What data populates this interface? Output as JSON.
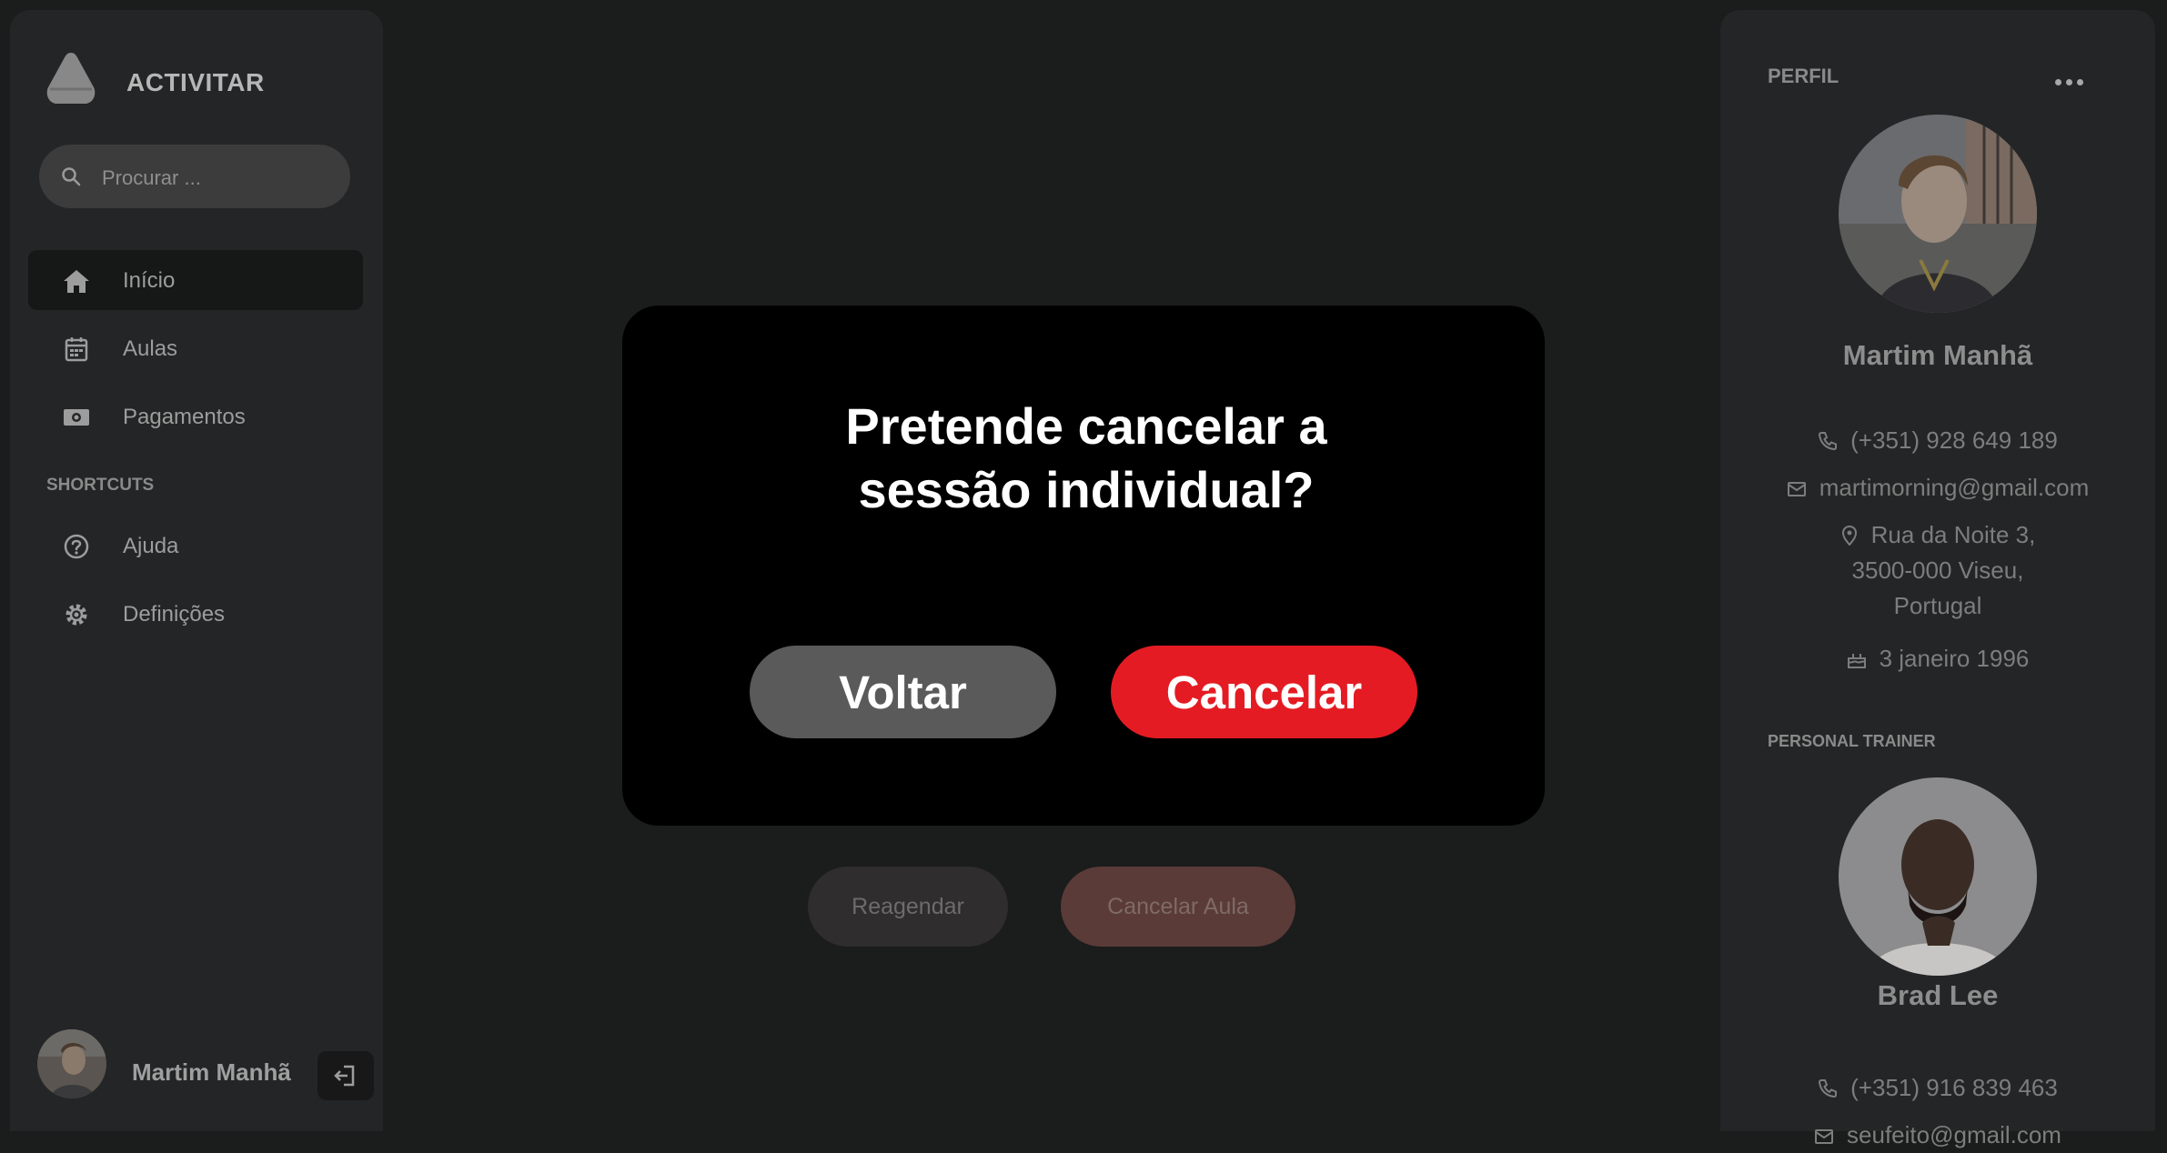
{
  "app": {
    "brand": "ACTIVITAR"
  },
  "search": {
    "placeholder": "Procurar ..."
  },
  "nav": {
    "items": [
      {
        "label": "Início",
        "icon": "home-icon"
      },
      {
        "label": "Aulas",
        "icon": "calendar-icon"
      },
      {
        "label": "Pagamentos",
        "icon": "money-icon"
      }
    ],
    "section": "SHORTCUTS",
    "shortcuts": [
      {
        "label": "Ajuda",
        "icon": "help-icon"
      },
      {
        "label": "Definições",
        "icon": "gear-icon"
      }
    ]
  },
  "user": {
    "name": "Martim Manhã"
  },
  "background_actions": {
    "reschedule": "Reagendar",
    "cancel_class": "Cancelar Aula"
  },
  "profile": {
    "title": "PERFIL",
    "name": "Martim Manhã",
    "phone": "(+351) 928 649 189",
    "email": "martimorning@gmail.com",
    "address_line1": "Rua da Noite 3,",
    "address_line2": "3500-000 Viseu,",
    "address_line3": "Portugal",
    "birthday": "3 janeiro 1996"
  },
  "trainer": {
    "title": "PERSONAL TRAINER",
    "name": "Brad Lee",
    "phone": "(+351) 916 839 463",
    "email": "seufeito@gmail.com"
  },
  "modal": {
    "title_line1": "Pretende cancelar a",
    "title_line2": "sessão individual?",
    "back": "Voltar",
    "confirm": "Cancelar"
  },
  "colors": {
    "accent": "#e41b23",
    "panel": "#242526",
    "background": "#1b1c1c"
  }
}
